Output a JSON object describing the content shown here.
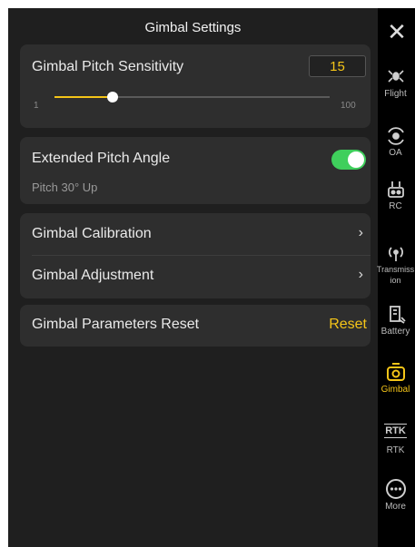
{
  "title": "Gimbal Settings",
  "pitch_sensitivity": {
    "label": "Gimbal Pitch Sensitivity",
    "value": "15",
    "min_label": "1",
    "max_label": "100",
    "slider_fraction": 0.21
  },
  "extended_pitch": {
    "label": "Extended Pitch Angle",
    "sublabel": "Pitch 30° Up",
    "enabled": true
  },
  "calibration": {
    "label": "Gimbal Calibration"
  },
  "adjustment": {
    "label": "Gimbal Adjustment"
  },
  "reset": {
    "label": "Gimbal Parameters Reset",
    "action_label": "Reset"
  },
  "nav": {
    "items": [
      {
        "id": "flight",
        "label": "Flight",
        "icon": "drone-icon"
      },
      {
        "id": "oa",
        "label": "OA",
        "icon": "obstacle-avoidance-icon"
      },
      {
        "id": "rc",
        "label": "RC",
        "icon": "remote-controller-icon"
      },
      {
        "id": "transmission",
        "label": "Transmission",
        "icon": "antenna-icon"
      },
      {
        "id": "battery",
        "label": "Battery",
        "icon": "battery-icon"
      },
      {
        "id": "gimbal",
        "label": "Gimbal",
        "icon": "gimbal-camera-icon",
        "active": true
      },
      {
        "id": "rtk",
        "label": "RTK",
        "icon": "rtk-icon"
      },
      {
        "id": "more",
        "label": "More",
        "icon": "more-icon"
      }
    ]
  },
  "colors": {
    "accent": "#f5c518",
    "toggle_on": "#3fcf5c"
  }
}
